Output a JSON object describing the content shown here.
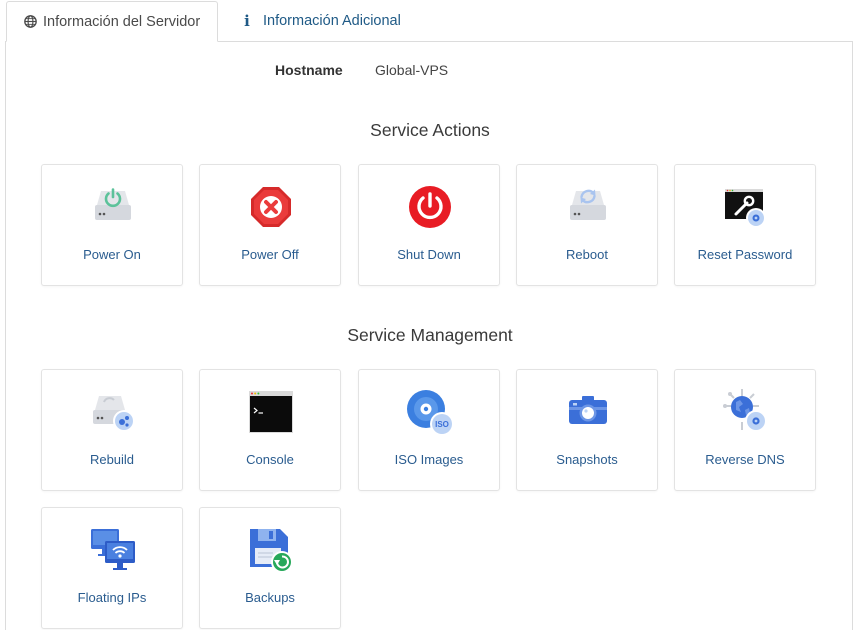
{
  "tabs": [
    {
      "label": "Información del Servidor",
      "icon": "globe-icon",
      "active": true
    },
    {
      "label": "Información Adicional",
      "icon": "info-icon",
      "active": false
    }
  ],
  "hostname": {
    "label": "Hostname",
    "value": "Global-VPS"
  },
  "service_actions": {
    "title": "Service Actions",
    "items": [
      {
        "label": "Power On",
        "icon": "power-on-icon"
      },
      {
        "label": "Power Off",
        "icon": "power-off-icon"
      },
      {
        "label": "Shut Down",
        "icon": "shut-down-icon"
      },
      {
        "label": "Reboot",
        "icon": "reboot-icon"
      },
      {
        "label": "Reset Password",
        "icon": "reset-password-icon"
      }
    ]
  },
  "service_management": {
    "title": "Service Management",
    "items": [
      {
        "label": "Rebuild",
        "icon": "rebuild-icon"
      },
      {
        "label": "Console",
        "icon": "console-icon"
      },
      {
        "label": "ISO Images",
        "icon": "iso-images-icon",
        "badge": "ISO"
      },
      {
        "label": "Snapshots",
        "icon": "camera-icon"
      },
      {
        "label": "Reverse DNS",
        "icon": "reverse-dns-icon"
      },
      {
        "label": "Floating IPs",
        "icon": "floating-ips-icon"
      },
      {
        "label": "Backups",
        "icon": "backups-icon"
      }
    ]
  },
  "colors": {
    "link": "#2a5c8f",
    "power_on": "#5cc29a",
    "danger": "#e02a2a",
    "accent_blue": "#3b6fd8"
  }
}
